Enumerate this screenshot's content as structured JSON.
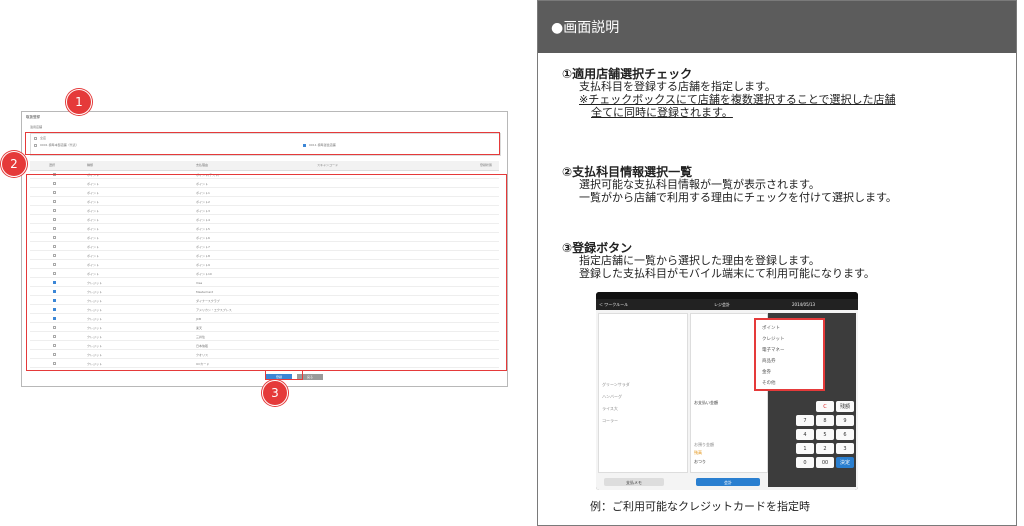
{
  "mock": {
    "title": "取扱登録",
    "store_section_label": "適用店舗",
    "store_all_label": "全店",
    "store_1_label": "0001 標準本部店舗（代表）",
    "store_2_label": "0011 標準運営店舗",
    "columns": [
      "選択",
      "種類",
      "支払理由",
      "スキャンコード",
      "登録状態"
    ],
    "rows": [
      {
        "checked": false,
        "kind": "ポイント",
        "reason": "ポイント(テスト)"
      },
      {
        "checked": false,
        "kind": "ポイント",
        "reason": "ポイント"
      },
      {
        "checked": false,
        "kind": "ポイント",
        "reason": "ポイント1"
      },
      {
        "checked": false,
        "kind": "ポイント",
        "reason": "ポイント2"
      },
      {
        "checked": false,
        "kind": "ポイント",
        "reason": "ポイント3"
      },
      {
        "checked": false,
        "kind": "ポイント",
        "reason": "ポイント4"
      },
      {
        "checked": false,
        "kind": "ポイント",
        "reason": "ポイント5"
      },
      {
        "checked": false,
        "kind": "ポイント",
        "reason": "ポイント6"
      },
      {
        "checked": false,
        "kind": "ポイント",
        "reason": "ポイント7"
      },
      {
        "checked": false,
        "kind": "ポイント",
        "reason": "ポイント8"
      },
      {
        "checked": false,
        "kind": "ポイント",
        "reason": "ポイント9"
      },
      {
        "checked": false,
        "kind": "ポイント",
        "reason": "ポイント10"
      },
      {
        "checked": true,
        "kind": "クレジット",
        "reason": "Visa"
      },
      {
        "checked": true,
        "kind": "クレジット",
        "reason": "MasterCard"
      },
      {
        "checked": true,
        "kind": "クレジット",
        "reason": "ダイナースクラブ"
      },
      {
        "checked": true,
        "kind": "クレジット",
        "reason": "アメリカン・エクスプレス"
      },
      {
        "checked": true,
        "kind": "クレジット",
        "reason": "JCB"
      },
      {
        "checked": false,
        "kind": "クレジット",
        "reason": "楽天"
      },
      {
        "checked": false,
        "kind": "クレジット",
        "reason": "三井住"
      },
      {
        "checked": false,
        "kind": "クレジット",
        "reason": "日本信販"
      },
      {
        "checked": false,
        "kind": "クレジット",
        "reason": "クオリス"
      },
      {
        "checked": false,
        "kind": "クレジット",
        "reason": "UCカード"
      }
    ],
    "register_button": "登録",
    "cancel_button": "戻る"
  },
  "badges": [
    "1",
    "2",
    "3"
  ],
  "panel": {
    "title": "●画面説明",
    "sections": [
      {
        "title": "①適用店舗選択チェック",
        "lines": [
          "支払科目を登録する店舗を指定します。"
        ],
        "underlined": [
          "※チェックボックスにて店舗を複数選択することで選択した店舗",
          "全てに同時に登録されます。"
        ]
      },
      {
        "title": "②支払科目情報選択一覧",
        "lines": [
          "選択可能な支払科目情報が一覧が表示されます。",
          "一覧がから店舗で利用する理由にチェックを付けて選択します。"
        ]
      },
      {
        "title": "③登録ボタン",
        "lines": [
          "指定店舗に一覧から選択した理由を登録します。",
          "登録した支払科目がモバイル端末にて利用可能になります。"
        ]
      }
    ],
    "caption": "例：ご利用可能なクレジットカードを指定時"
  },
  "tablet": {
    "header_center": "レジ会計",
    "date": "2014/05/13",
    "back_label": "＜ ワークルール",
    "popup_items": [
      "ポイント",
      "クレジット",
      "電子マネー",
      "商品券",
      "金券",
      "その他"
    ],
    "left_items": [
      "グリーンサラダ",
      "ハンバーグ",
      "ライス大",
      "コーラー"
    ],
    "mid_labels": [
      "お支払い金額",
      "お預り金額",
      "残高",
      "おつり"
    ],
    "keys": [
      "C",
      "残額",
      "7",
      "8",
      "9",
      "4",
      "5",
      "6",
      "1",
      "2",
      "3",
      "0",
      "00",
      "決定"
    ],
    "bottom_left": "支払メモ",
    "bottom_right": "会計"
  },
  "colors": {
    "accent_red": "#e53a3a",
    "accent_blue": "#3b86d6",
    "panel_header": "#5c5c5c"
  }
}
